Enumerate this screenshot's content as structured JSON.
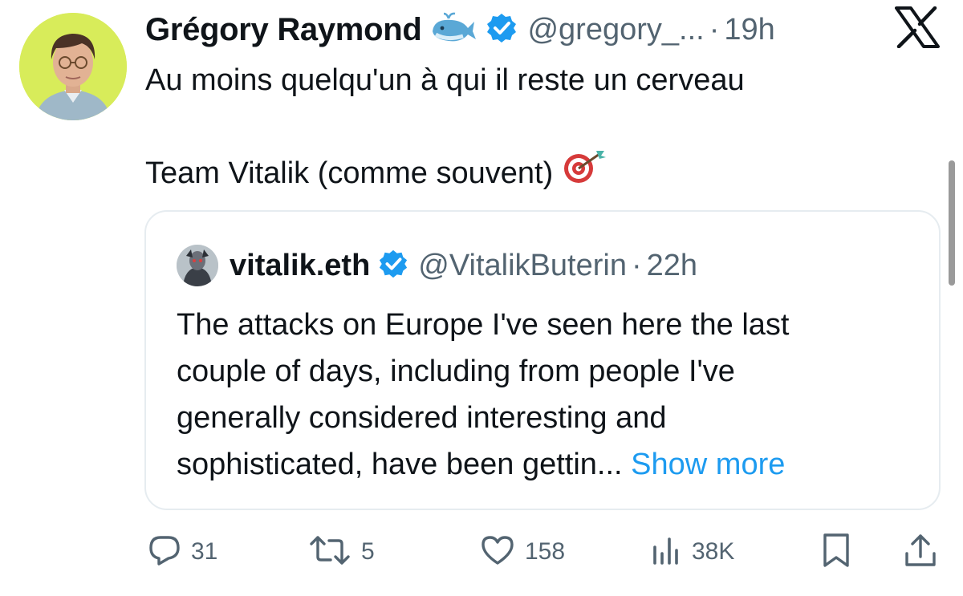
{
  "tweet": {
    "author_name": "Grégory Raymond",
    "author_emoji": "whale-emoji-icon",
    "handle": "@gregory_...",
    "separator": "·",
    "time": "19h",
    "text_line1": "Au moins quelqu'un à qui il reste un cerveau",
    "text_line2": "Team Vitalik (comme souvent)",
    "text_emoji": "direct-hit-emoji-icon"
  },
  "quote": {
    "author_name": "vitalik.eth",
    "handle": "@VitalikButerin",
    "separator": "·",
    "time": "22h",
    "lines": [
      "The attacks on Europe I've seen here the last",
      "couple of days, including from people I've",
      "generally considered interesting and",
      "sophisticated, have been gettin..."
    ],
    "show_more": "Show more"
  },
  "actions": {
    "replies": "31",
    "reposts": "5",
    "likes": "158",
    "views": "38K"
  },
  "colors": {
    "text": "#0f1419",
    "secondary": "#536471",
    "accent": "#1d9bf0",
    "border": "#e6ecf0",
    "avatar_bg": "#d8ec5a"
  }
}
